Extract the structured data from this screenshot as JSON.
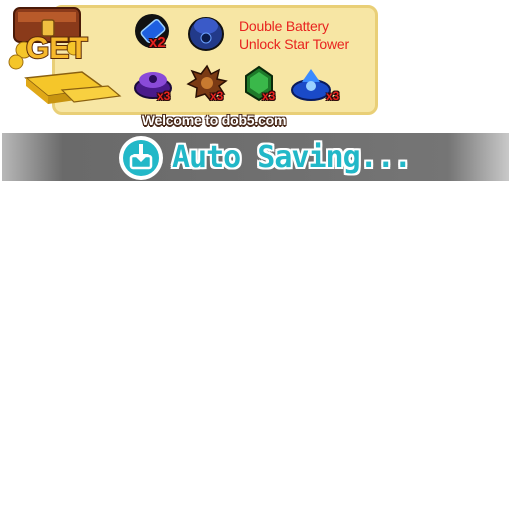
{
  "reward_panel": {
    "get_label": "GET",
    "promo_line_1": "Double Battery",
    "promo_line_2": "Unlock Star Tower",
    "items": [
      {
        "icon": "battery-icon",
        "qty": "x2"
      },
      {
        "icon": "star-tower-icon",
        "qty": ""
      },
      {
        "icon": "purple-key-tower-icon",
        "qty": "x3"
      },
      {
        "icon": "brown-spiked-key-tower-icon",
        "qty": "x3"
      },
      {
        "icon": "green-key-tower-icon",
        "qty": "x3"
      },
      {
        "icon": "blue-key-tower-icon",
        "qty": "x3"
      }
    ]
  },
  "welcome_text": "Welcome to dob5.com",
  "status": {
    "saving_text": "Auto Saving...",
    "icon": "download-save-icon"
  },
  "colors": {
    "panel_bg": "#f7e6a4",
    "promo_text": "#e8231f",
    "saving_text": "#22b8c8",
    "bar": "#6f6f6f"
  }
}
